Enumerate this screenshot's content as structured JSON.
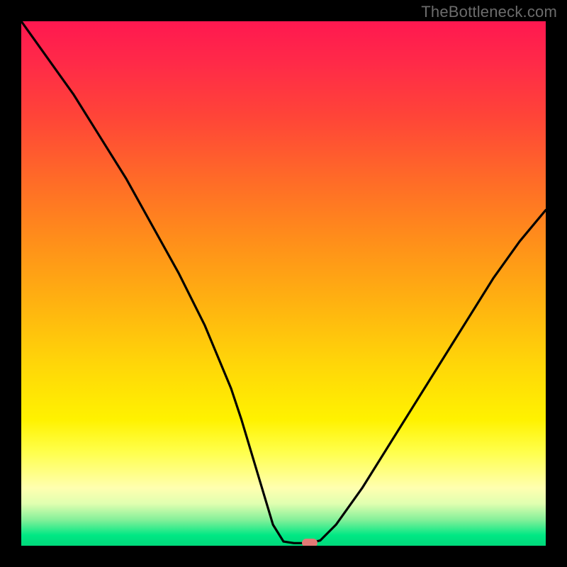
{
  "watermark": "TheBottleneck.com",
  "colors": {
    "background": "#000000",
    "curve": "#000000",
    "marker": "#e27a76",
    "gradient_top": "#ff1850",
    "gradient_bottom": "#00d87a"
  },
  "chart_data": {
    "type": "line",
    "title": "",
    "xlabel": "",
    "ylabel": "",
    "xlim": [
      0,
      100
    ],
    "ylim": [
      0,
      100
    ],
    "grid": false,
    "legend": false,
    "notes": "Single V-shaped bottleneck curve over a red-to-green vertical gradient. Minimum (optimal / no-bottleneck point) is marked with a small pink pill near the bottom center-right. Axes have no tick labels.",
    "series": [
      {
        "name": "bottleneck-curve",
        "x": [
          0,
          5,
          10,
          15,
          20,
          25,
          30,
          35,
          40,
          42,
          45,
          48,
          50,
          52,
          55,
          57,
          60,
          65,
          70,
          75,
          80,
          85,
          90,
          95,
          100
        ],
        "y": [
          100,
          93,
          86,
          78,
          70,
          61,
          52,
          42,
          30,
          24,
          14,
          4,
          0.8,
          0.5,
          0.5,
          1,
          4,
          11,
          19,
          27,
          35,
          43,
          51,
          58,
          64
        ]
      }
    ],
    "marker": {
      "x": 55,
      "y": 0.5,
      "label": "optimal-point"
    }
  }
}
